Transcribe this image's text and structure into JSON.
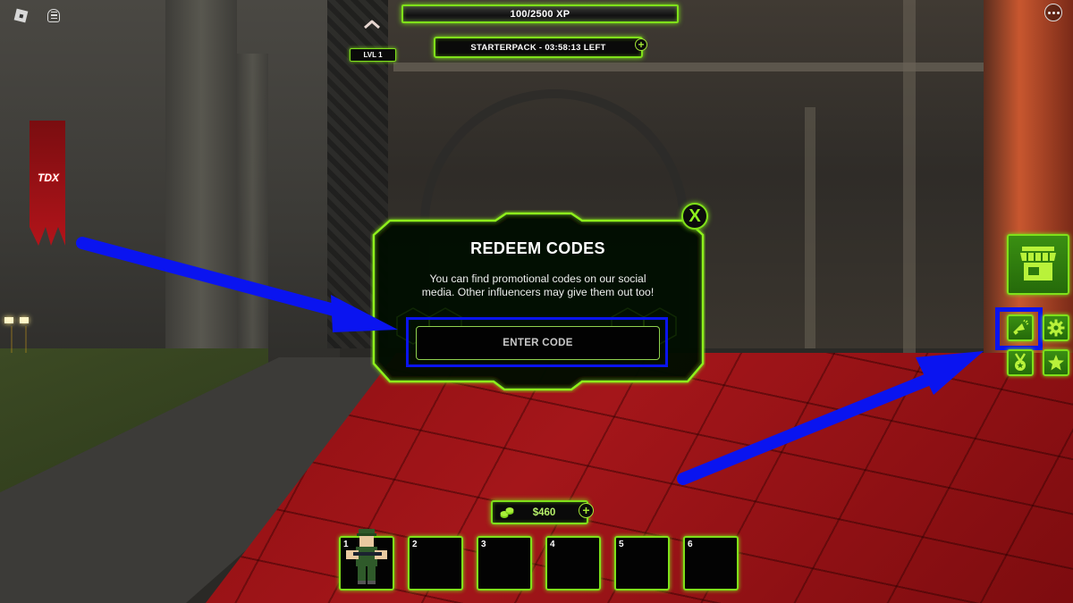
{
  "topbar": {
    "roblox_menu_icon": "roblox-logo-icon",
    "chat_icon": "chat-icon",
    "more_icon": "more-options-icon"
  },
  "hud": {
    "xp_text": "100/2500 XP",
    "xp_current": 100,
    "xp_max": 2500,
    "level_label": "LVL 1",
    "starterpack_text": "STARTERPACK - 03:58:13 LEFT",
    "starterpack_plus": "+",
    "collapse_icon": "chevron-up-icon"
  },
  "scene": {
    "banner_logo": "TDX"
  },
  "redeem_modal": {
    "title": "REDEEM CODES",
    "description": "You can find promotional codes on our social media. Other influencers may give them out too!",
    "input_placeholder": "ENTER CODE",
    "input_value": "",
    "close_label": "X"
  },
  "side_menu": {
    "shop_icon": "shop-icon",
    "codes_icon": "megaphone-icon",
    "settings_icon": "gear-icon",
    "achievements_icon": "medal-icon",
    "favorites_icon": "star-icon"
  },
  "currency": {
    "money": "$460",
    "plus": "+"
  },
  "hotbar": {
    "slots": [
      {
        "number": "1",
        "unit": "soldier"
      },
      {
        "number": "2",
        "unit": ""
      },
      {
        "number": "3",
        "unit": ""
      },
      {
        "number": "4",
        "unit": ""
      },
      {
        "number": "5",
        "unit": ""
      },
      {
        "number": "6",
        "unit": ""
      }
    ]
  },
  "colors": {
    "neon_green": "#7fe01a",
    "annotation_blue": "#0a14f0",
    "floor_red": "#a4161a"
  }
}
